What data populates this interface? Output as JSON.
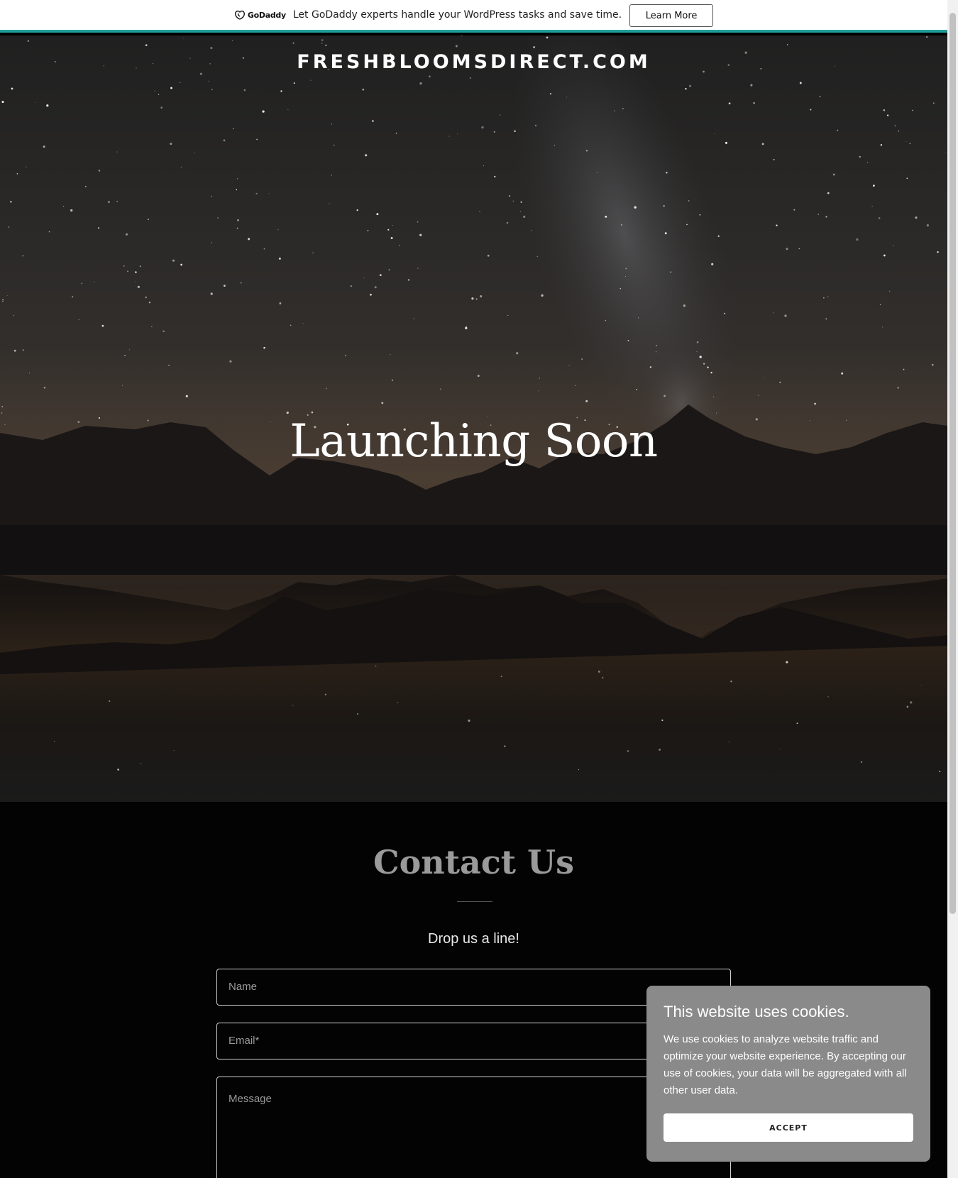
{
  "promo": {
    "logo_text": "GoDaddy",
    "message": "Let GoDaddy experts handle your WordPress tasks and save time.",
    "button_label": "Learn More",
    "accent_color": "#1f9d9d"
  },
  "hero": {
    "site_title": "FRESHBLOOMSDIRECT.COM",
    "heading": "Launching Soon"
  },
  "contact": {
    "title": "Contact Us",
    "subtitle": "Drop us a line!",
    "fields": {
      "name_placeholder": "Name",
      "email_placeholder": "Email*",
      "message_placeholder": "Message"
    }
  },
  "cookie_banner": {
    "title": "This website uses cookies.",
    "body": "We use cookies to analyze website traffic and optimize your website experience. By accepting our use of cookies, your data will be aggregated with all other user data.",
    "accept_label": "ACCEPT"
  }
}
